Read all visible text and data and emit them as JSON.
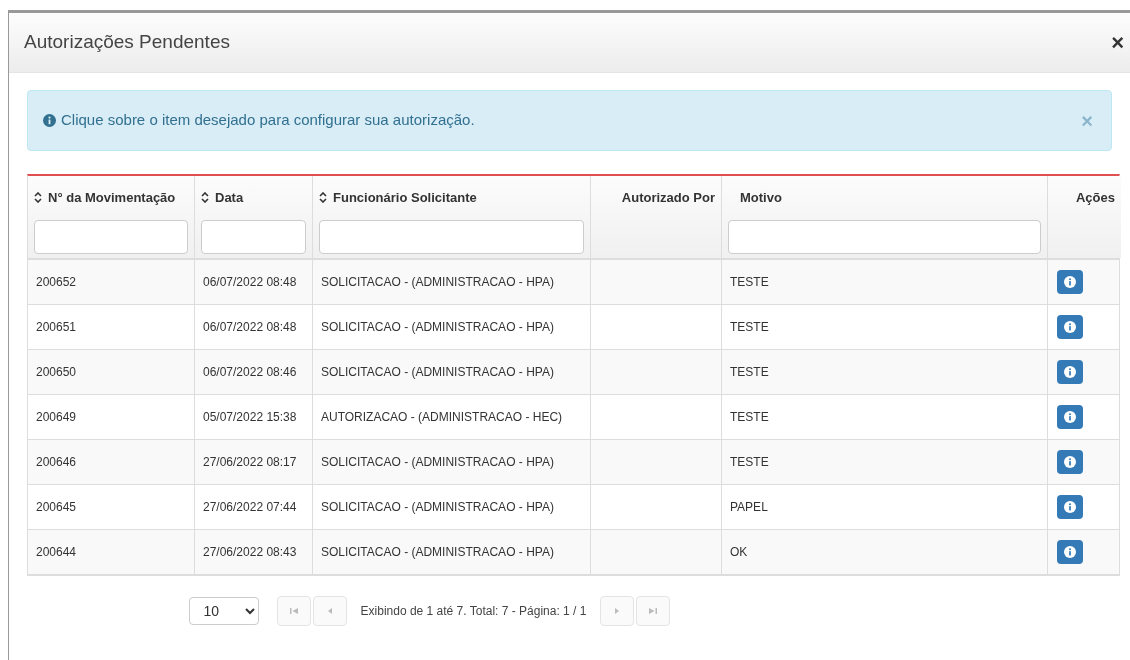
{
  "modal": {
    "title": "Autorizações Pendentes",
    "close": "×"
  },
  "alert": {
    "text": "Clique sobre o item desejado para configurar sua autorização.",
    "close": "×"
  },
  "table": {
    "columns": [
      {
        "label": "N° da Movimentação",
        "sortable": true,
        "filter": true
      },
      {
        "label": "Data",
        "sortable": true,
        "filter": true
      },
      {
        "label": "Funcionário Solicitante",
        "sortable": true,
        "filter": true
      },
      {
        "label": "Autorizado Por",
        "sortable": false,
        "filter": false
      },
      {
        "label": "Motivo",
        "sortable": false,
        "filter": true
      },
      {
        "label": "Ações",
        "sortable": false,
        "filter": false
      }
    ],
    "rows": [
      [
        "200652",
        "06/07/2022 08:48",
        "SOLICITACAO - (ADMINISTRACAO - HPA)",
        "",
        "TESTE"
      ],
      [
        "200651",
        "06/07/2022 08:48",
        "SOLICITACAO - (ADMINISTRACAO - HPA)",
        "",
        "TESTE"
      ],
      [
        "200650",
        "06/07/2022 08:46",
        "SOLICITACAO - (ADMINISTRACAO - HPA)",
        "",
        "TESTE"
      ],
      [
        "200649",
        "05/07/2022 15:38",
        "AUTORIZACAO - (ADMINISTRACAO - HEC)",
        "",
        "TESTE"
      ],
      [
        "200646",
        "27/06/2022 08:17",
        "SOLICITACAO - (ADMINISTRACAO - HPA)",
        "",
        "TESTE"
      ],
      [
        "200645",
        "27/06/2022 07:44",
        "SOLICITACAO - (ADMINISTRACAO - HPA)",
        "",
        "PAPEL"
      ],
      [
        "200644",
        "27/06/2022 08:43",
        "SOLICITACAO - (ADMINISTRACAO - HPA)",
        "",
        "OK"
      ]
    ]
  },
  "pagination": {
    "page_size": "10",
    "summary": "Exibindo de 1 até 7. Total: 7 - Página: 1 / 1",
    "first_disabled": true,
    "prev_disabled": true,
    "next_disabled": true,
    "last_disabled": true
  }
}
